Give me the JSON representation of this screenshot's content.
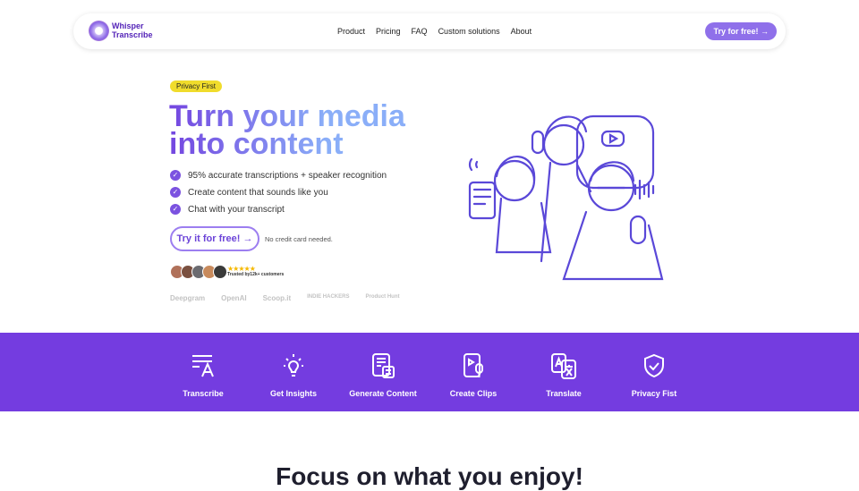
{
  "nav": {
    "brand_line1": "Whisper",
    "brand_line2": "Transcribe",
    "menu": [
      "Product",
      "Pricing",
      "FAQ",
      "Custom solutions",
      "About"
    ],
    "cta": "Try for free! →"
  },
  "hero": {
    "badge": "Privacy First",
    "title": "Turn your media into content",
    "features": [
      "95% accurate transcriptions + speaker recognition",
      "Create content that sounds like you",
      "Chat with your transcript"
    ],
    "cta": "Try it for free! →",
    "cta_note": "No credit card needed.",
    "stars": "★★★★★",
    "trust": "Trusted by12k+ customers",
    "logos": [
      "Deepgram",
      "OpenAI",
      "Scoop.it",
      "INDIE HACKERS",
      "Product Hunt"
    ]
  },
  "features_band": {
    "color": "#743ce0",
    "items": [
      {
        "label": "Transcribe",
        "icon": "text-transcribe-icon"
      },
      {
        "label": "Get Insights",
        "icon": "lightbulb-icon"
      },
      {
        "label": "Generate Content",
        "icon": "document-icon"
      },
      {
        "label": "Create Clips",
        "icon": "video-mic-icon"
      },
      {
        "label": "Translate",
        "icon": "translate-icon"
      },
      {
        "label": "Privacy Fist",
        "icon": "shield-check-icon"
      }
    ]
  },
  "section": {
    "title": "Focus on what you enjoy!"
  }
}
